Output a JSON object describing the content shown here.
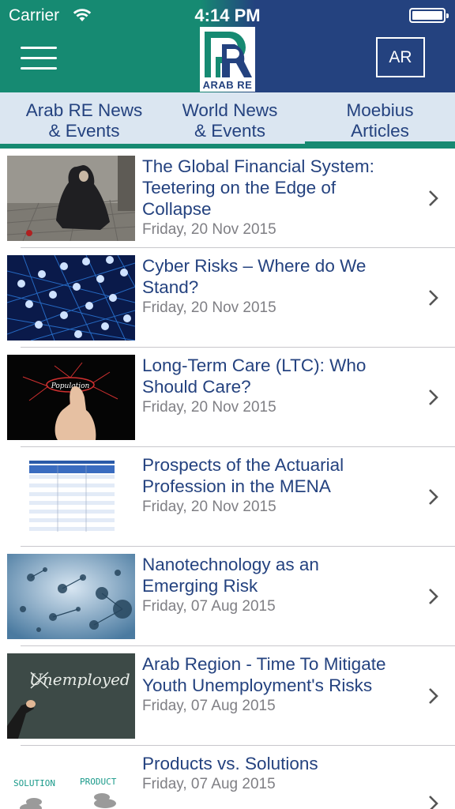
{
  "status_bar": {
    "carrier": "Carrier",
    "time": "4:14 PM"
  },
  "header": {
    "logo_text": "ARAB RE",
    "language_button": "AR"
  },
  "tabs": [
    {
      "line1": "Arab RE News",
      "line2": "& Events"
    },
    {
      "line1": "World News",
      "line2": "& Events"
    },
    {
      "line1": "Moebius",
      "line2": "Articles"
    }
  ],
  "colors": {
    "teal": "#168a72",
    "navy": "#24427f",
    "tab_bg": "#dbe6f1",
    "date_gray": "#7f7f84"
  },
  "articles": [
    {
      "title_lines": [
        "The Global Financial System:",
        "Teetering on the Edge of",
        "Collapse"
      ],
      "date": "Friday, 20 Nov 2015",
      "thumb": "woman-sitting-image"
    },
    {
      "title_lines": [
        "Cyber Risks – Where do We",
        "Stand?"
      ],
      "date": "Friday, 20 Nov 2015",
      "thumb": "network-locks-image"
    },
    {
      "title_lines": [
        "Long-Term Care (LTC): Who",
        "Should Care?"
      ],
      "date": "Friday, 20 Nov 2015",
      "thumb": "population-diagram-image"
    },
    {
      "title_lines": [
        "Prospects of the Actuarial",
        "Profession in the MENA"
      ],
      "date": "Friday, 20 Nov 2015",
      "thumb": "actuarial-table-image"
    },
    {
      "title_lines": [
        "Nanotechnology as an",
        "Emerging Risk"
      ],
      "date": "Friday, 07 Aug 2015",
      "thumb": "molecules-image"
    },
    {
      "title_lines": [
        "Arab Region - Time To Mitigate",
        "Youth Unemployment's Risks"
      ],
      "date": "Friday, 07 Aug 2015",
      "thumb": "chalkboard-unemployed-image"
    },
    {
      "title_lines": [
        "Products vs. Solutions"
      ],
      "date": "Friday, 07 Aug 2015",
      "thumb": "solution-product-image"
    }
  ],
  "thumb_text": {
    "population": "Population",
    "unemployed": "Unemployed",
    "solution": "SOLUTION",
    "product": "PRODUCT"
  }
}
